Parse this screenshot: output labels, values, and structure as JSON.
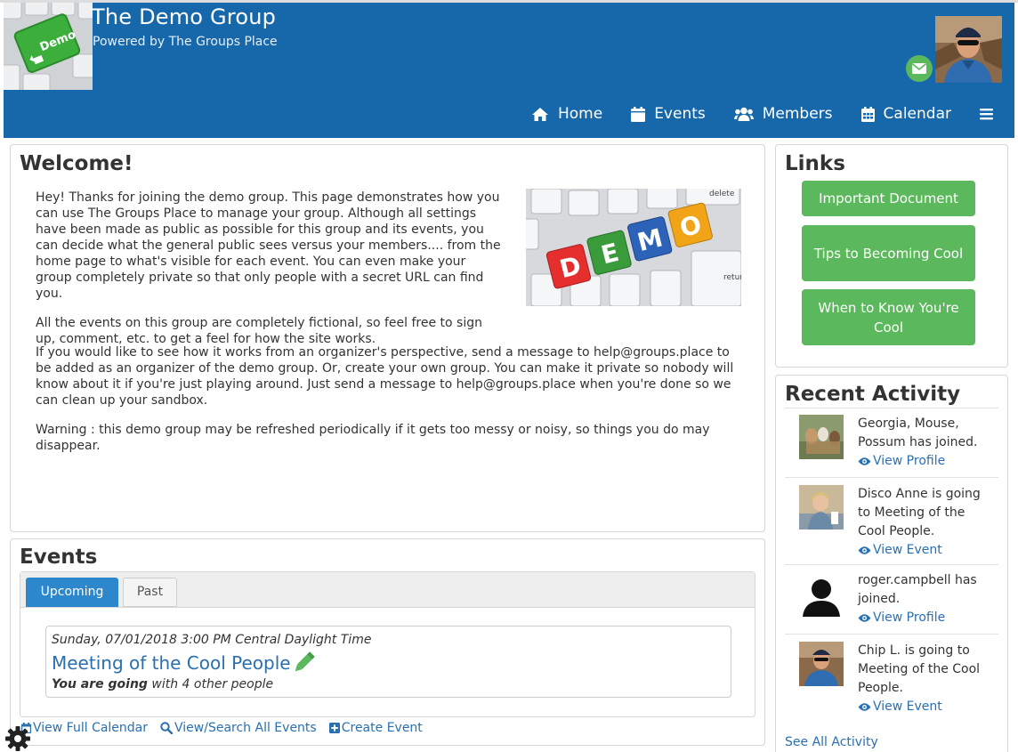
{
  "header": {
    "site_title": "The Demo Group",
    "site_subtitle": "Powered by The Groups Place",
    "logo_key_label": "Demo",
    "mail_icon": "envelope-icon"
  },
  "nav": {
    "items": [
      {
        "label": "Home",
        "icon": "home-icon"
      },
      {
        "label": "Events",
        "icon": "calendar-check-icon"
      },
      {
        "label": "Members",
        "icon": "users-icon"
      },
      {
        "label": "Calendar",
        "icon": "calendar-icon"
      }
    ],
    "menu_icon": "bars-icon"
  },
  "welcome": {
    "title": "Welcome!",
    "paragraphs": [
      "Hey! Thanks for joining the demo group. This page demonstrates how you can use The Groups Place to manage your group. Although all settings have been made as public as possible for this group and its events, you can decide what the general public sees versus your members.... from the home page to what's visible for each event.  You can even make your group completely private so that only people with a secret URL can find you.",
      "All the events on this group are completely fictional, so feel free to sign up, comment, etc. to get a feel for how the site works.",
      "If you would like to see how it works from an organizer's perspective, send a message to help@groups.place to be added as an organizer of the demo group. Or, create your own group. You can make it private so nobody will know about it if you're just playing around. Just send a message to help@groups.place when you're done so we can clean up your sandbox.",
      "Warning : this demo group may be refreshed periodically if it gets too messy or noisy, so things you do may disappear."
    ],
    "image_letters": [
      "D",
      "E",
      "M",
      "O"
    ],
    "image_key_labels": [
      "delete",
      "return"
    ]
  },
  "events": {
    "title": "Events",
    "tabs": [
      {
        "label": "Upcoming",
        "active": true
      },
      {
        "label": "Past",
        "active": false
      }
    ],
    "items": [
      {
        "date": "Sunday, 07/01/2018 3:00 PM Central Daylight Time",
        "title": "Meeting of the Cool People",
        "going_bold": "You are going",
        "going_rest": " with 4 other people"
      }
    ],
    "links": {
      "calendar": "View Full Calendar",
      "search": "View/Search All Events",
      "create": "Create Event"
    }
  },
  "links": {
    "title": "Links",
    "buttons": [
      {
        "label": "Important Document"
      },
      {
        "label": "Tips to Becoming Cool"
      },
      {
        "label": "When to Know You're Cool"
      }
    ]
  },
  "activity": {
    "title": "Recent Activity",
    "items": [
      {
        "text": "Georgia, Mouse, Possum has joined.",
        "link": "View Profile"
      },
      {
        "text": "Disco Anne is going to Meeting of the Cool People.",
        "link": "View Event"
      },
      {
        "text": "roger.campbell has joined.",
        "link": "View Profile"
      },
      {
        "text": "Chip L. is going to Meeting of the Cool People.",
        "link": "View Event"
      }
    ],
    "see_all": "See All Activity"
  },
  "colors": {
    "header_blue": "#1768ab",
    "link_blue": "#2a6fb0",
    "tab_blue": "#2d87cc",
    "button_green": "#5cb85c"
  }
}
